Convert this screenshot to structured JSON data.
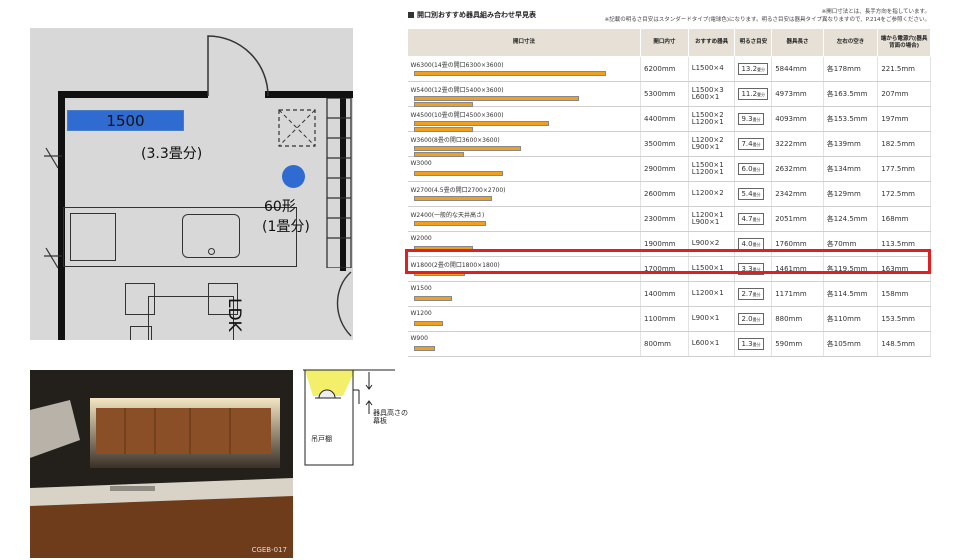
{
  "floor_plan": {
    "light_label": "1500",
    "light_area": "(3.3畳分)",
    "downlight_type": "60形",
    "downlight_area": "(1畳分)",
    "room_label": "LDK",
    "colors": {
      "fixture": "#2f6bd1",
      "background": "#d8d8d8"
    }
  },
  "table": {
    "title": "開口別おすすめ器具組み合わせ早見表",
    "note1": "※開口寸法とは、長手方向を指しています。",
    "note2": "※記載の明るさ目安はスタンダードタイプ(電球色)になります。明るさ目安は器具タイプ異なりますので、P.214をご参照ください。",
    "headers": [
      "開口寸法",
      "開口内寸",
      "おすすめ器具",
      "明るさ目安",
      "器具長さ",
      "左右の空き",
      "端から電源穴(器具背面の場合)"
    ],
    "rows": [
      {
        "name": "W6300(14畳の開口6300×3600)",
        "inner": "6200mm",
        "fixture": [
          "L1500×4"
        ],
        "bright": "13.2",
        "length": "5844mm",
        "gap": "各178mm",
        "hole": "221.5mm",
        "bars": [
          1.0
        ]
      },
      {
        "name": "W5400(12畳の開口5400×3600)",
        "inner": "5300mm",
        "fixture": [
          "L1500×3",
          "L600×1"
        ],
        "bright": "11.2",
        "length": "4973mm",
        "gap": "各163.5mm",
        "hole": "207mm",
        "bars": [
          0.86,
          0.3
        ]
      },
      {
        "name": "W4500(10畳の開口4500×3600)",
        "inner": "4400mm",
        "fixture": [
          "L1500×2",
          "L1200×1"
        ],
        "bright": "9.3",
        "length": "4093mm",
        "gap": "各153.5mm",
        "hole": "197mm",
        "bars": [
          0.7,
          0.3
        ]
      },
      {
        "name": "W3600(8畳の開口3600×3600)",
        "inner": "3500mm",
        "fixture": [
          "L1200×2",
          "L900×1"
        ],
        "bright": "7.4",
        "length": "3222mm",
        "gap": "各139mm",
        "hole": "182.5mm",
        "bars": [
          0.55,
          0.25
        ]
      },
      {
        "name": "W3000",
        "inner": "2900mm",
        "fixture": [
          "L1500×1",
          "L1200×1"
        ],
        "bright": "6.0",
        "length": "2632mm",
        "gap": "各134mm",
        "hole": "177.5mm",
        "bars": [
          0.46
        ]
      },
      {
        "name": "W2700(4.5畳の開口2700×2700)",
        "inner": "2600mm",
        "fixture": [
          "L1200×2"
        ],
        "bright": "5.4",
        "length": "2342mm",
        "gap": "各129mm",
        "hole": "172.5mm",
        "bars": [
          0.4
        ]
      },
      {
        "name": "W2400(一般的な天井高さ)",
        "inner": "2300mm",
        "fixture": [
          "L1200×1",
          "L900×1"
        ],
        "bright": "4.7",
        "length": "2051mm",
        "gap": "各124.5mm",
        "hole": "168mm",
        "bars": [
          0.37
        ]
      },
      {
        "name": "W2000",
        "inner": "1900mm",
        "fixture": [
          "L900×2"
        ],
        "bright": "4.0",
        "length": "1760mm",
        "gap": "各70mm",
        "hole": "113.5mm",
        "bars": [
          0.3
        ]
      },
      {
        "name": "W1800(2畳の開口1800×1800)",
        "inner": "1700mm",
        "fixture": [
          "L1500×1"
        ],
        "bright": "3.3",
        "length": "1461mm",
        "gap": "各119.5mm",
        "hole": "163mm",
        "bars": [
          0.26
        ]
      },
      {
        "name": "W1500",
        "inner": "1400mm",
        "fixture": [
          "L1200×1"
        ],
        "bright": "2.7",
        "length": "1171mm",
        "gap": "各114.5mm",
        "hole": "158mm",
        "bars": [
          0.19
        ]
      },
      {
        "name": "W1200",
        "inner": "1100mm",
        "fixture": [
          "L900×1"
        ],
        "bright": "2.0",
        "length": "880mm",
        "gap": "各110mm",
        "hole": "153.5mm",
        "bars": [
          0.14
        ]
      },
      {
        "name": "W900",
        "inner": "800mm",
        "fixture": [
          "L600×1"
        ],
        "bright": "1.3",
        "length": "590mm",
        "gap": "各105mm",
        "hole": "148.5mm",
        "bars": [
          0.1
        ]
      }
    ],
    "bright_unit": "畳分",
    "highlight_row": "W1800(2畳の開口1800×1800)",
    "highlight_color": "#e02020"
  },
  "photo": {
    "caption": "CGEB-017"
  },
  "section": {
    "label_valance": "器具高さの幕板",
    "label_cabinet": "吊戸棚"
  }
}
